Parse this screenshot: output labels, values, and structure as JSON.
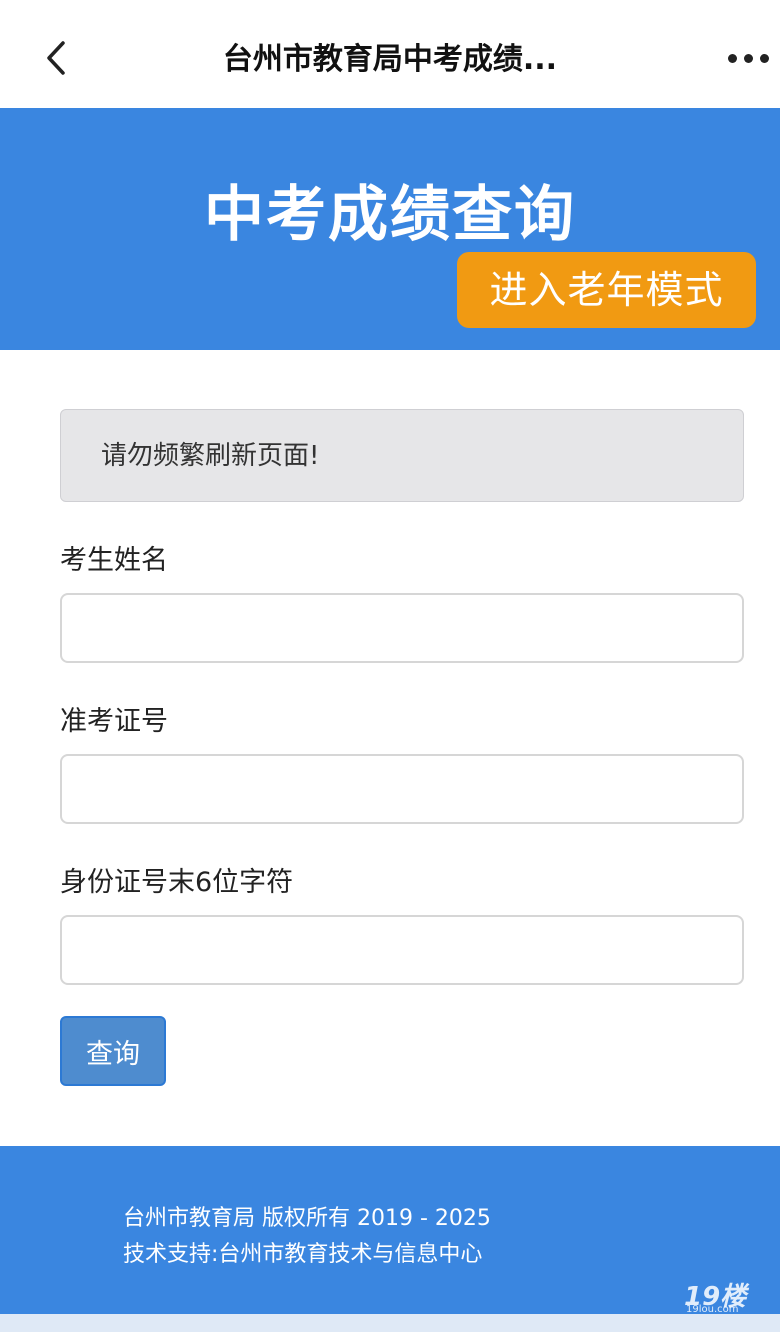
{
  "nav": {
    "title": "台州市教育局中考成绩...",
    "back_icon": "chevron-left-icon",
    "more_icon": "more-horizontal-icon"
  },
  "hero": {
    "title": "中考成绩查询",
    "elder_mode_label": "进入老年模式",
    "background": "#3a86e0",
    "button_color": "#f19a12"
  },
  "notice": {
    "text": "请勿频繁刷新页面!"
  },
  "form": {
    "name_label": "考生姓名",
    "name_value": "",
    "ticket_label": "准考证号",
    "ticket_value": "",
    "id_label": "身份证号末6位字符",
    "id_value": "",
    "submit_label": "查询"
  },
  "footer": {
    "copyright": "台州市教育局 版权所有 2019 - 2025",
    "support": "技术支持:台州市教育技术与信息中心"
  },
  "watermark": {
    "brand": "19楼",
    "domain": "19lou.com"
  }
}
